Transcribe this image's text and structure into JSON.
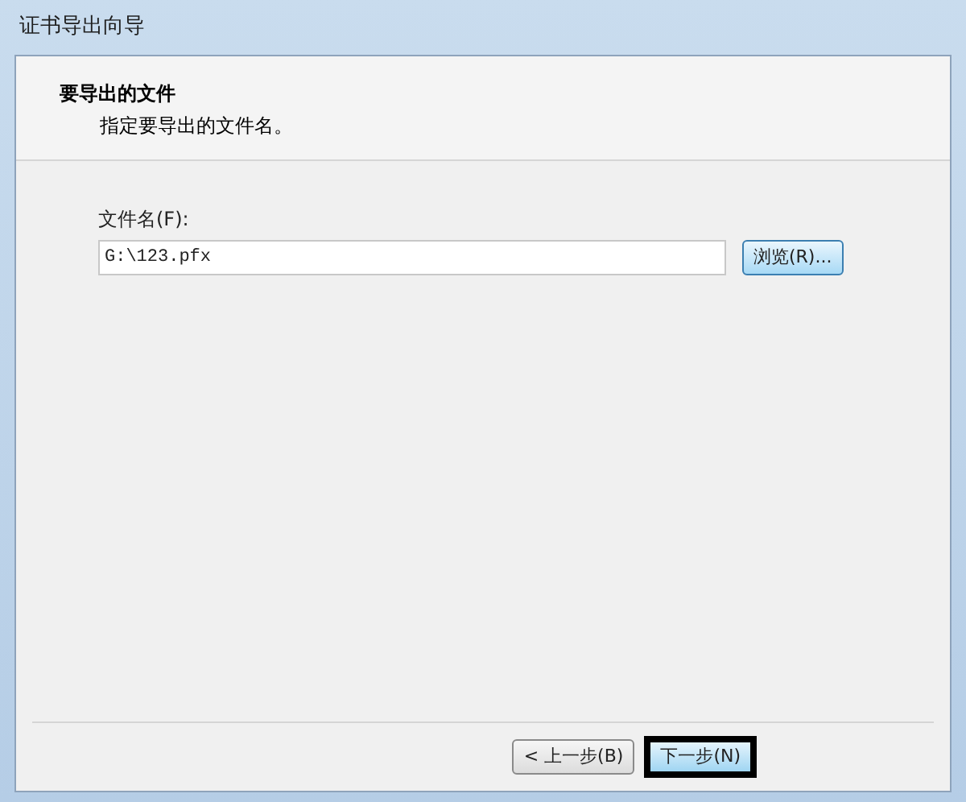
{
  "window": {
    "title": "证书导出向导"
  },
  "header": {
    "title": "要导出的文件",
    "subtitle": "指定要导出的文件名。"
  },
  "file_field": {
    "label": "文件名(F):",
    "value": "G:\\123.pfx"
  },
  "browse_button": {
    "label": "浏览(R)..."
  },
  "buttons": [
    {
      "label": "< 上一步(B)",
      "focused": false
    },
    {
      "label": "下一步(N)",
      "focused": true
    }
  ]
}
